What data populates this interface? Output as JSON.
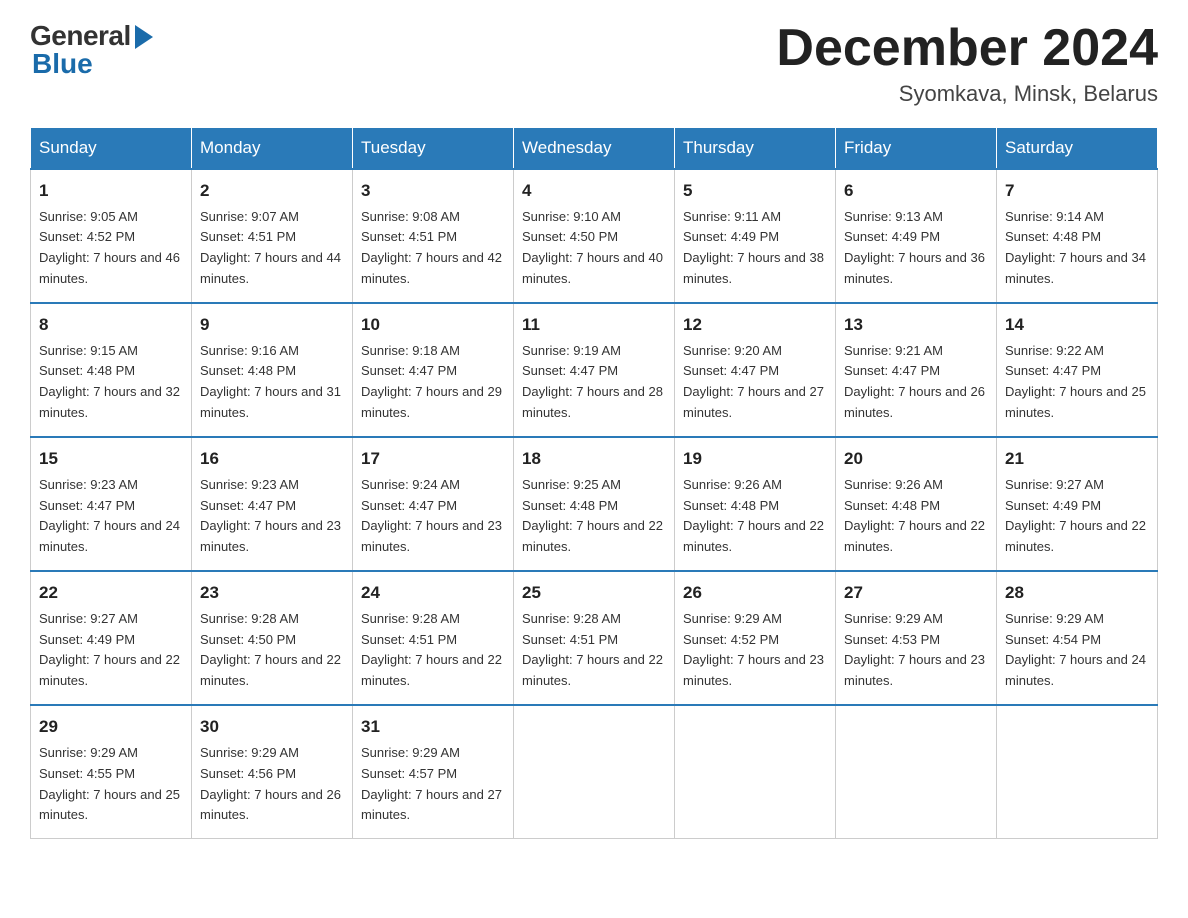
{
  "header": {
    "logo_general": "General",
    "logo_blue": "Blue",
    "month_title": "December 2024",
    "location": "Syomkava, Minsk, Belarus"
  },
  "weekdays": [
    "Sunday",
    "Monday",
    "Tuesday",
    "Wednesday",
    "Thursday",
    "Friday",
    "Saturday"
  ],
  "weeks": [
    [
      {
        "day": "1",
        "sunrise": "9:05 AM",
        "sunset": "4:52 PM",
        "daylight": "7 hours and 46 minutes."
      },
      {
        "day": "2",
        "sunrise": "9:07 AM",
        "sunset": "4:51 PM",
        "daylight": "7 hours and 44 minutes."
      },
      {
        "day": "3",
        "sunrise": "9:08 AM",
        "sunset": "4:51 PM",
        "daylight": "7 hours and 42 minutes."
      },
      {
        "day": "4",
        "sunrise": "9:10 AM",
        "sunset": "4:50 PM",
        "daylight": "7 hours and 40 minutes."
      },
      {
        "day": "5",
        "sunrise": "9:11 AM",
        "sunset": "4:49 PM",
        "daylight": "7 hours and 38 minutes."
      },
      {
        "day": "6",
        "sunrise": "9:13 AM",
        "sunset": "4:49 PM",
        "daylight": "7 hours and 36 minutes."
      },
      {
        "day": "7",
        "sunrise": "9:14 AM",
        "sunset": "4:48 PM",
        "daylight": "7 hours and 34 minutes."
      }
    ],
    [
      {
        "day": "8",
        "sunrise": "9:15 AM",
        "sunset": "4:48 PM",
        "daylight": "7 hours and 32 minutes."
      },
      {
        "day": "9",
        "sunrise": "9:16 AM",
        "sunset": "4:48 PM",
        "daylight": "7 hours and 31 minutes."
      },
      {
        "day": "10",
        "sunrise": "9:18 AM",
        "sunset": "4:47 PM",
        "daylight": "7 hours and 29 minutes."
      },
      {
        "day": "11",
        "sunrise": "9:19 AM",
        "sunset": "4:47 PM",
        "daylight": "7 hours and 28 minutes."
      },
      {
        "day": "12",
        "sunrise": "9:20 AM",
        "sunset": "4:47 PM",
        "daylight": "7 hours and 27 minutes."
      },
      {
        "day": "13",
        "sunrise": "9:21 AM",
        "sunset": "4:47 PM",
        "daylight": "7 hours and 26 minutes."
      },
      {
        "day": "14",
        "sunrise": "9:22 AM",
        "sunset": "4:47 PM",
        "daylight": "7 hours and 25 minutes."
      }
    ],
    [
      {
        "day": "15",
        "sunrise": "9:23 AM",
        "sunset": "4:47 PM",
        "daylight": "7 hours and 24 minutes."
      },
      {
        "day": "16",
        "sunrise": "9:23 AM",
        "sunset": "4:47 PM",
        "daylight": "7 hours and 23 minutes."
      },
      {
        "day": "17",
        "sunrise": "9:24 AM",
        "sunset": "4:47 PM",
        "daylight": "7 hours and 23 minutes."
      },
      {
        "day": "18",
        "sunrise": "9:25 AM",
        "sunset": "4:48 PM",
        "daylight": "7 hours and 22 minutes."
      },
      {
        "day": "19",
        "sunrise": "9:26 AM",
        "sunset": "4:48 PM",
        "daylight": "7 hours and 22 minutes."
      },
      {
        "day": "20",
        "sunrise": "9:26 AM",
        "sunset": "4:48 PM",
        "daylight": "7 hours and 22 minutes."
      },
      {
        "day": "21",
        "sunrise": "9:27 AM",
        "sunset": "4:49 PM",
        "daylight": "7 hours and 22 minutes."
      }
    ],
    [
      {
        "day": "22",
        "sunrise": "9:27 AM",
        "sunset": "4:49 PM",
        "daylight": "7 hours and 22 minutes."
      },
      {
        "day": "23",
        "sunrise": "9:28 AM",
        "sunset": "4:50 PM",
        "daylight": "7 hours and 22 minutes."
      },
      {
        "day": "24",
        "sunrise": "9:28 AM",
        "sunset": "4:51 PM",
        "daylight": "7 hours and 22 minutes."
      },
      {
        "day": "25",
        "sunrise": "9:28 AM",
        "sunset": "4:51 PM",
        "daylight": "7 hours and 22 minutes."
      },
      {
        "day": "26",
        "sunrise": "9:29 AM",
        "sunset": "4:52 PM",
        "daylight": "7 hours and 23 minutes."
      },
      {
        "day": "27",
        "sunrise": "9:29 AM",
        "sunset": "4:53 PM",
        "daylight": "7 hours and 23 minutes."
      },
      {
        "day": "28",
        "sunrise": "9:29 AM",
        "sunset": "4:54 PM",
        "daylight": "7 hours and 24 minutes."
      }
    ],
    [
      {
        "day": "29",
        "sunrise": "9:29 AM",
        "sunset": "4:55 PM",
        "daylight": "7 hours and 25 minutes."
      },
      {
        "day": "30",
        "sunrise": "9:29 AM",
        "sunset": "4:56 PM",
        "daylight": "7 hours and 26 minutes."
      },
      {
        "day": "31",
        "sunrise": "9:29 AM",
        "sunset": "4:57 PM",
        "daylight": "7 hours and 27 minutes."
      },
      null,
      null,
      null,
      null
    ]
  ]
}
